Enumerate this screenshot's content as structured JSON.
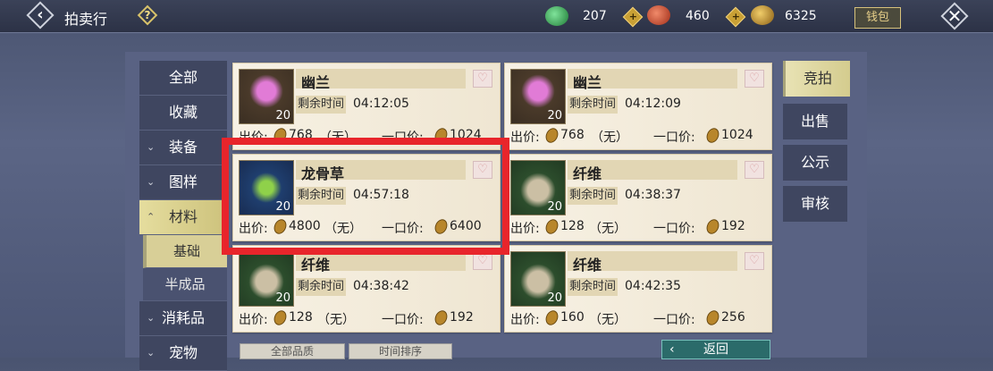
{
  "header": {
    "title": "拍卖行",
    "help": "?",
    "wallet": "钱包"
  },
  "currencies": [
    {
      "name": "jade-coin",
      "value": "207",
      "color": "#2e9c45"
    },
    {
      "name": "red-crystal",
      "value": "460",
      "color": "#c04a2c"
    },
    {
      "name": "gold-seed",
      "value": "6325",
      "color": "#c08c2e"
    }
  ],
  "sidebar": {
    "items": [
      {
        "label": "全部"
      },
      {
        "label": "收藏"
      },
      {
        "label": "装备"
      },
      {
        "label": "图样"
      },
      {
        "label": "材料"
      },
      {
        "label": "基础"
      },
      {
        "label": "半成品"
      },
      {
        "label": "消耗品"
      },
      {
        "label": "宠物"
      }
    ]
  },
  "right_tabs": [
    "竞拍",
    "出售",
    "公示",
    "审核"
  ],
  "listings": [
    {
      "name": "幽兰",
      "qty": "20",
      "time_label": "剩余时间",
      "time": "04:12:05",
      "bid_label": "出价:",
      "bid": "768",
      "bid_note": "（无）",
      "buyout_label": "一口价:",
      "buyout": "1024",
      "icon": "orchid-icon"
    },
    {
      "name": "幽兰",
      "qty": "20",
      "time_label": "剩余时间",
      "time": "04:12:09",
      "bid_label": "出价:",
      "bid": "768",
      "bid_note": "（无）",
      "buyout_label": "一口价:",
      "buyout": "1024",
      "icon": "orchid-icon"
    },
    {
      "name": "龙骨草",
      "qty": "20",
      "time_label": "剩余时间",
      "time": "04:57:18",
      "bid_label": "出价:",
      "bid": "4800",
      "bid_note": "（无）",
      "buyout_label": "一口价:",
      "buyout": "6400",
      "icon": "leaf-icon"
    },
    {
      "name": "纤维",
      "qty": "20",
      "time_label": "剩余时间",
      "time": "04:38:37",
      "bid_label": "出价:",
      "bid": "128",
      "bid_note": "（无）",
      "buyout_label": "一口价:",
      "buyout": "192",
      "icon": "fiber-icon"
    },
    {
      "name": "纤维",
      "qty": "20",
      "time_label": "剩余时间",
      "time": "04:38:42",
      "bid_label": "出价:",
      "bid": "128",
      "bid_note": "（无）",
      "buyout_label": "一口价:",
      "buyout": "192",
      "icon": "fiber-icon"
    },
    {
      "name": "纤维",
      "qty": "20",
      "time_label": "剩余时间",
      "time": "04:42:35",
      "bid_label": "出价:",
      "bid": "160",
      "bid_note": "（无）",
      "buyout_label": "一口价:",
      "buyout": "256",
      "icon": "fiber-icon"
    }
  ],
  "bottom": {
    "quality": "全部品质",
    "sort": "时间排序",
    "return": "返回"
  },
  "colors": {
    "highlight": "#e8252b",
    "active_tab": "#d8cf97"
  }
}
